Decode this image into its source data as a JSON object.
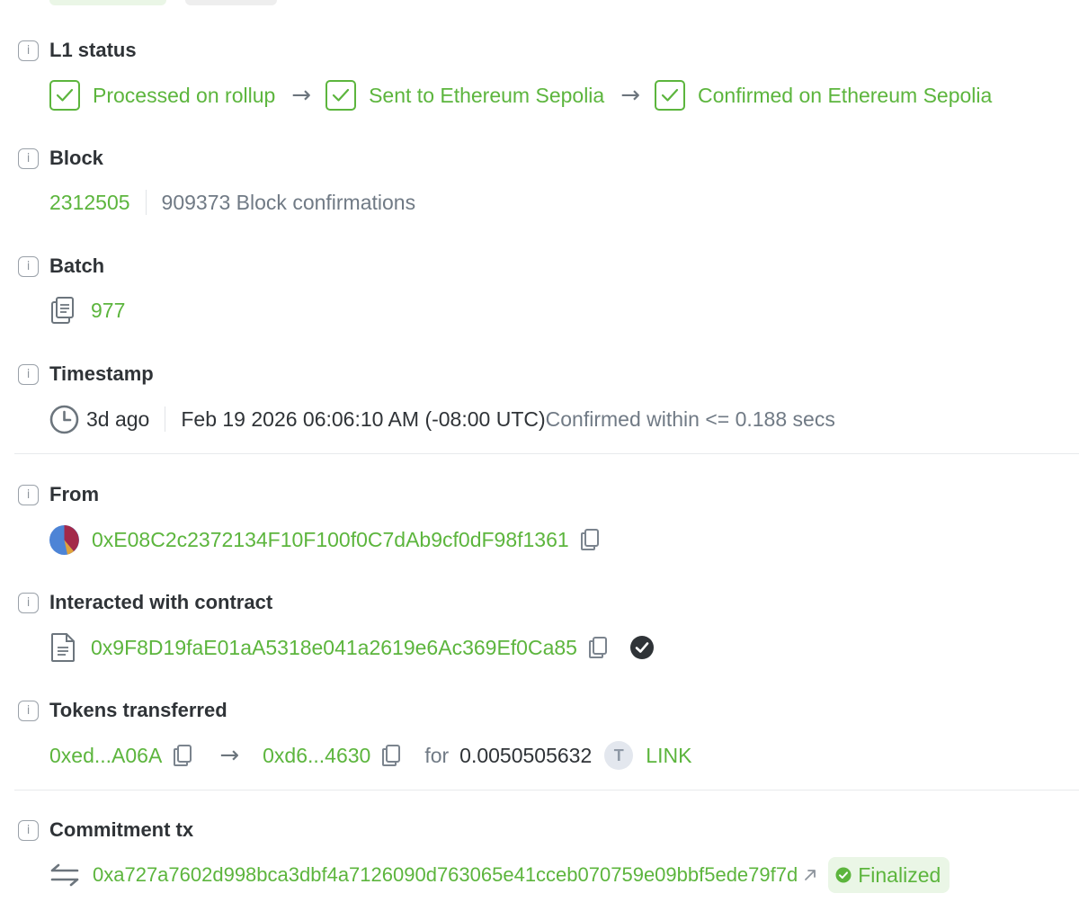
{
  "l1_status": {
    "label": "L1 status",
    "steps": [
      "Processed on rollup",
      "Sent to Ethereum Sepolia",
      "Confirmed on Ethereum Sepolia"
    ]
  },
  "block": {
    "label": "Block",
    "number": "2312505",
    "confirmations": "909373 Block confirmations"
  },
  "batch": {
    "label": "Batch",
    "number": "977"
  },
  "timestamp": {
    "label": "Timestamp",
    "relative": "3d ago",
    "absolute": "Feb 19 2026 06:06:10 AM (-08:00 UTC)",
    "confirmed": "Confirmed within <= 0.188 secs"
  },
  "from": {
    "label": "From",
    "address": "0xE08C2c2372134F10F100f0C7dAb9cf0dF98f1361"
  },
  "contract": {
    "label": "Interacted with contract",
    "address": "0x9F8D19faE01aA5318e041a2619e6Ac369Ef0Ca85"
  },
  "tokens": {
    "label": "Tokens transferred",
    "from": "0xed...A06A",
    "to": "0xd6...4630",
    "for_label": "for",
    "amount": "0.0050505632",
    "token_initial": "T",
    "token_symbol": "LINK"
  },
  "commitment": {
    "label": "Commitment tx",
    "hash": "0xa727a7602d998bca3dbf4a7126090d763065e41cceb070759e09bbf5ede79f7d",
    "status": "Finalized"
  },
  "colors": {
    "accent_green": "#5cb53d",
    "muted_grey": "#707a85",
    "finalized_bg": "#eaf6e6"
  }
}
